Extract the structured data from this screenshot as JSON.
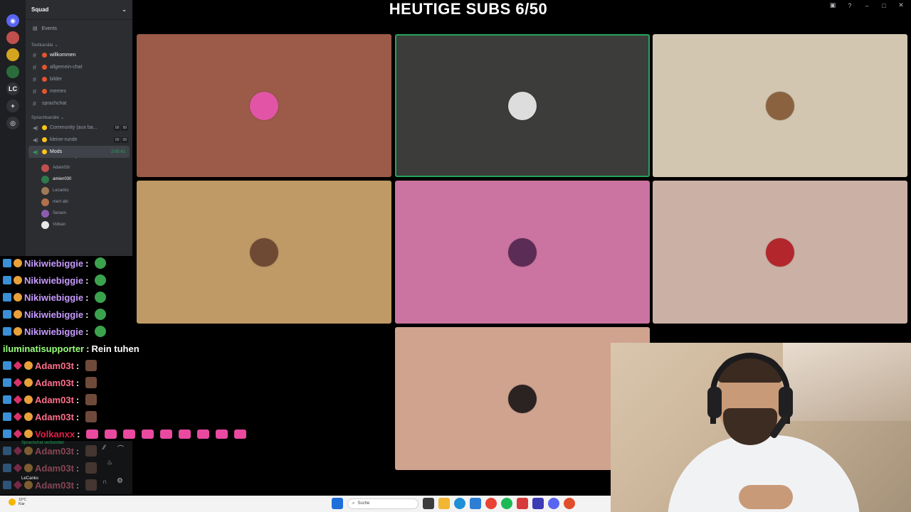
{
  "overlay": {
    "title": "HEUTIGE SUBS 6/50"
  },
  "discord": {
    "server_name": "Squad",
    "events_label": "Events",
    "categories": {
      "text": "Textkanäle",
      "voice": "Sprachkanäle"
    },
    "text_channels": [
      {
        "name": "willkommen",
        "active": true
      },
      {
        "name": "allgemein-chat",
        "active": false
      },
      {
        "name": "bilder",
        "active": false
      },
      {
        "name": "memes",
        "active": false
      }
    ],
    "plain_channel": "sprachchat",
    "voice_channels": [
      {
        "name": "Community (aux ba...",
        "counts": [
          "00",
          "99"
        ]
      },
      {
        "name": "kleine-runde",
        "counts": [
          "00",
          "09"
        ]
      },
      {
        "name": "Mods",
        "timer": "2:05:41",
        "selected": true
      }
    ],
    "channel_status": "Kanalstatus festlegen",
    "members": [
      {
        "name": "Adam03r",
        "color": "#c0504d"
      },
      {
        "name": "amien030",
        "color": "#2f7a4b",
        "bright": true
      },
      {
        "name": "Lecanko",
        "color": "#a07a58"
      },
      {
        "name": "mert abi",
        "color": "#b0704a"
      },
      {
        "name": "Senem",
        "color": "#8b5cb0"
      },
      {
        "name": "Volkan",
        "color": "#e8e8e8"
      }
    ],
    "voice_connected": "Sprachchat verbunden",
    "user_name": "LeCanko"
  },
  "video_tiles": [
    {
      "bg": "#9c5a48",
      "avatar": "#e255a6",
      "speaking": false
    },
    {
      "bg": "#3c3c3b",
      "avatar": "#dddddd",
      "speaking": true
    },
    {
      "bg": "#d2c6b0",
      "avatar": "#8a6240",
      "speaking": false
    },
    {
      "bg": "#c09a66",
      "avatar": "#6e4a35",
      "speaking": false
    },
    {
      "bg": "#cb74a1",
      "avatar": "#5b2c55",
      "speaking": false
    },
    {
      "bg": "#cbb0a6",
      "avatar": "#b3262c",
      "speaking": false
    },
    {
      "bg": "#cfa38e",
      "avatar": "#2b2222",
      "speaking": false
    }
  ],
  "chat": {
    "messages": [
      {
        "user": "Nikiwiebiggie",
        "color": "#c79bfe",
        "badges": [
          "prime",
          "sub"
        ],
        "sep": " :",
        "text": "",
        "emotes": [
          "green"
        ]
      },
      {
        "user": "Nikiwiebiggie",
        "color": "#c79bfe",
        "badges": [
          "prime",
          "sub"
        ],
        "sep": " :",
        "text": "",
        "emotes": [
          "green"
        ]
      },
      {
        "user": "Nikiwiebiggie",
        "color": "#c79bfe",
        "badges": [
          "prime",
          "sub"
        ],
        "sep": " :",
        "text": "",
        "emotes": [
          "green"
        ]
      },
      {
        "user": "Nikiwiebiggie",
        "color": "#c79bfe",
        "badges": [
          "prime",
          "sub"
        ],
        "sep": " :",
        "text": "",
        "emotes": [
          "green"
        ]
      },
      {
        "user": "Nikiwiebiggie",
        "color": "#c79bfe",
        "badges": [
          "prime",
          "sub"
        ],
        "sep": " :",
        "text": "",
        "emotes": [
          "green"
        ]
      },
      {
        "user": "iluminatisupporter",
        "color": "#9aff7d",
        "badges": [],
        "sep": " :",
        "text": " Rein tuhen",
        "emotes": []
      },
      {
        "user": "Adam03t",
        "color": "#ff6f8a",
        "badges": [
          "prime",
          "vip",
          "sub"
        ],
        "sep": " :",
        "text": "",
        "emotes": [
          "face"
        ]
      },
      {
        "user": "Adam03t",
        "color": "#ff6f8a",
        "badges": [
          "prime",
          "vip",
          "sub"
        ],
        "sep": " :",
        "text": "",
        "emotes": [
          "face"
        ]
      },
      {
        "user": "Adam03t",
        "color": "#ff6f8a",
        "badges": [
          "prime",
          "vip",
          "sub"
        ],
        "sep": " :",
        "text": "",
        "emotes": [
          "face"
        ]
      },
      {
        "user": "Adam03t",
        "color": "#ff6f8a",
        "badges": [
          "prime",
          "vip",
          "sub"
        ],
        "sep": " :",
        "text": "",
        "emotes": [
          "face"
        ]
      },
      {
        "user": "Volkanxx",
        "color": "#e0204a",
        "badges": [
          "prime",
          "vip",
          "sub"
        ],
        "sep": " :",
        "text": "",
        "emotes": [
          "pink",
          "pink",
          "pink",
          "pink",
          "pink",
          "pink",
          "pink",
          "pink",
          "pink"
        ]
      },
      {
        "user": "Adam03t",
        "color": "#ff6f8a",
        "badges": [
          "prime",
          "vip",
          "sub"
        ],
        "sep": " :",
        "text": "",
        "emotes": [
          "face"
        ]
      },
      {
        "user": "Adam03t",
        "color": "#ff6f8a",
        "badges": [
          "prime",
          "vip",
          "sub"
        ],
        "sep": " :",
        "text": "",
        "emotes": [
          "face"
        ]
      },
      {
        "user": "Adam03t",
        "color": "#ff6f8a",
        "badges": [
          "prime",
          "vip",
          "sub"
        ],
        "sep": " :",
        "text": "",
        "emotes": [
          "face"
        ]
      }
    ]
  },
  "taskbar": {
    "weather_temp": "10°C",
    "weather_desc": "Klar",
    "search_placeholder": "Suche"
  }
}
